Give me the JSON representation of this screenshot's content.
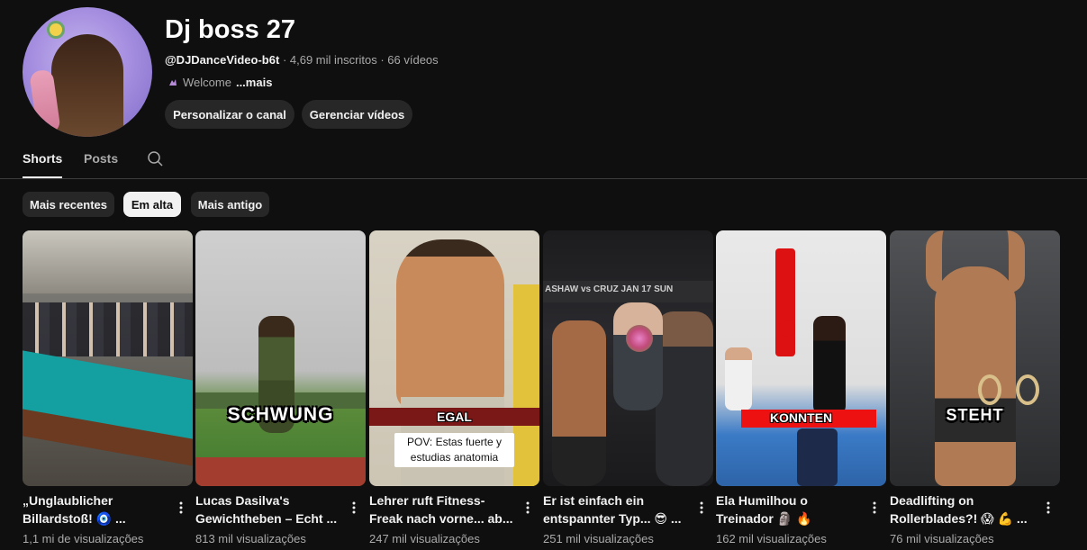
{
  "channel": {
    "name": "Dj boss 27",
    "handle": "@DJDanceVideo-b6t",
    "subscribers": "4,69 mil inscritos",
    "videos": "66 vídeos",
    "description": "Welcome",
    "more_label": "...mais",
    "customize_button": "Personalizar o canal",
    "manage_button": "Gerenciar vídeos"
  },
  "tabs": [
    {
      "label": "Shorts",
      "active": true
    },
    {
      "label": "Posts",
      "active": false
    }
  ],
  "chips": [
    {
      "label": "Mais recentes",
      "active": false
    },
    {
      "label": "Em alta",
      "active": true
    },
    {
      "label": "Mais antigo",
      "active": false
    }
  ],
  "shorts": [
    {
      "title_line1": "„Unglaublicher",
      "title_line2": "Billardstoß! 🧿 ...",
      "views": "1,1 mi de visualizações",
      "caption": ""
    },
    {
      "title_line1": "Lucas Dasilva's",
      "title_line2": "Gewichtheben – Echt ...",
      "views": "813 mil visualizações",
      "caption": "SCHWUNG"
    },
    {
      "title_line1": "Lehrer ruft Fitness-",
      "title_line2": "Freak nach vorne... ab...",
      "views": "247 mil visualizações",
      "caption": "EGAL",
      "overlay_text": "POV: Estas fuerte y estudias anatomia"
    },
    {
      "title_line1": "Er ist einfach ein",
      "title_line2": "entspannter Typ... 😎 ...",
      "views": "251 mil visualizações",
      "caption": "",
      "banner": "ASHAW vs CRUZ   JAN 17 SUN"
    },
    {
      "title_line1": "Ela Humilhou o",
      "title_line2": "Treinador 🗿 🔥 #shorts",
      "views": "162 mil visualizações",
      "caption": "KONNTEN"
    },
    {
      "title_line1": "Deadlifting on",
      "title_line2": "Rollerblades?! 😱 💪 ...",
      "views": "76 mil visualizações",
      "caption": "STEHT"
    }
  ],
  "colors": {
    "background": "#0f0f0f",
    "chip_bg": "#272727",
    "chip_active_bg": "#f1f1f1",
    "text_primary": "#f1f1f1",
    "text_secondary": "#aaaaaa"
  }
}
